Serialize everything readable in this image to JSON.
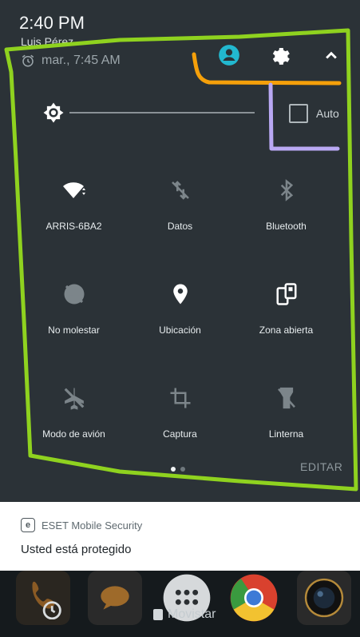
{
  "status": {
    "time": "2:40 PM",
    "owner_text": "Luis Pérez"
  },
  "alarm": {
    "text": "mar., 7:45 AM",
    "icon": "alarm-clock-icon"
  },
  "header": {
    "icons": [
      {
        "name": "user-icon",
        "color": "#22b8cf"
      },
      {
        "name": "gear-icon",
        "color": "#ffffff"
      },
      {
        "name": "chevron-up-icon",
        "color": "#ffffff"
      }
    ]
  },
  "brightness": {
    "auto_label": "Auto",
    "auto_checked": false
  },
  "tiles": [
    {
      "label": "ARRIS-6BA2",
      "icon": "wifi-icon",
      "enabled": true
    },
    {
      "label": "Datos",
      "icon": "data-off-icon",
      "enabled": false
    },
    {
      "label": "Bluetooth",
      "icon": "bluetooth-icon",
      "enabled": false
    },
    {
      "label": "No molestar",
      "icon": "do-not-disturb-icon",
      "enabled": false
    },
    {
      "label": "Ubicación",
      "icon": "location-pin-icon",
      "enabled": true
    },
    {
      "label": "Zona abierta",
      "icon": "hotspot-icon",
      "enabled": true
    },
    {
      "label": "Modo de avión",
      "icon": "airplane-icon",
      "enabled": false
    },
    {
      "label": "Captura",
      "icon": "crop-icon",
      "enabled": false
    },
    {
      "label": "Linterna",
      "icon": "flashlight-icon",
      "enabled": false
    }
  ],
  "pager": {
    "pages": 2,
    "active": 0
  },
  "edit_label": "EDITAR",
  "notification": {
    "app": "ESET Mobile Security",
    "app_icon_letter": "e",
    "text": "Usted está protegido"
  },
  "dock": {
    "carrier": "Movistar",
    "apps": [
      "phone-icon",
      "messages-icon",
      "app-drawer-icon",
      "chrome-icon",
      "camera-icon"
    ]
  },
  "colors": {
    "panel_bg": "#2b3237",
    "highlight_green": "#8fd21f",
    "highlight_orange": "#f5a00a",
    "highlight_purple": "#b9a8f3"
  }
}
